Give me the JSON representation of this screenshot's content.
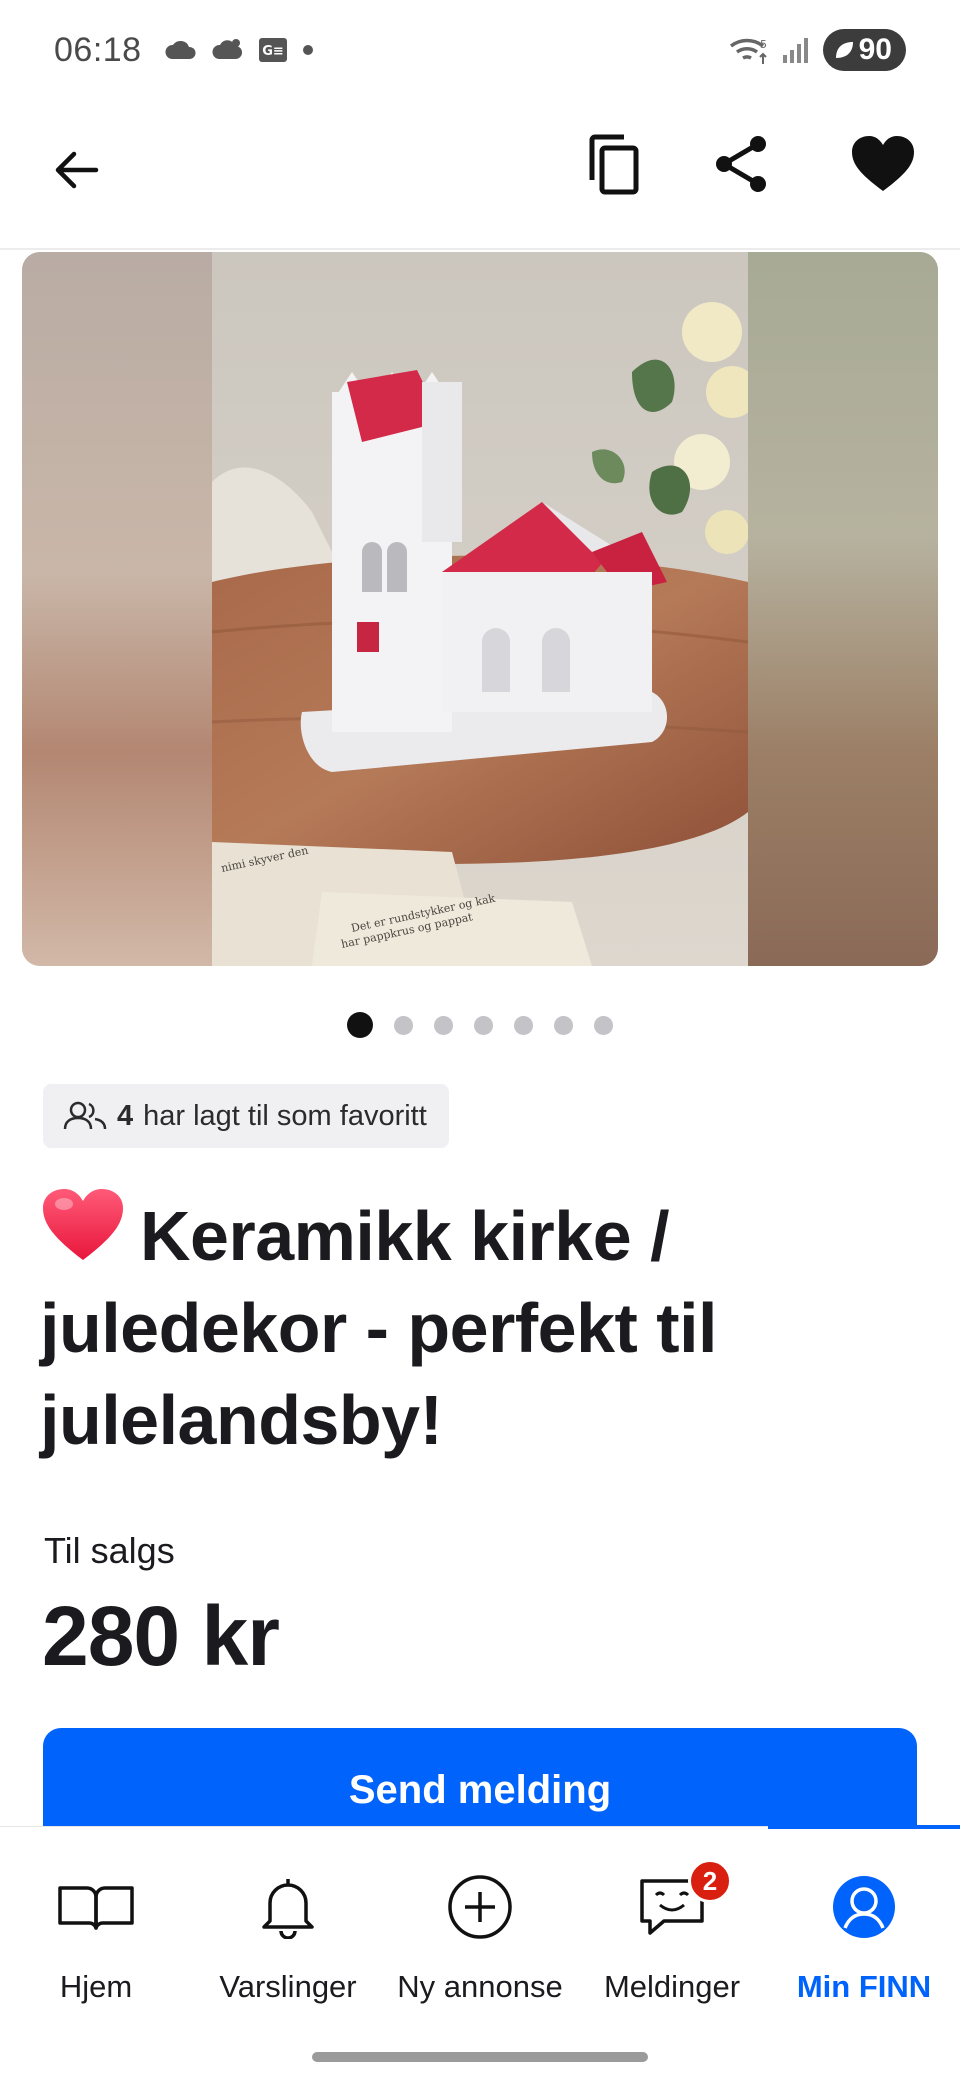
{
  "status_bar": {
    "time": "06:18",
    "battery": "90",
    "icons_left": [
      "cloud-icon",
      "cloud-rain-icon",
      "sim-card-icon",
      "dot-icon"
    ],
    "icons_right": [
      "wifi-icon",
      "signal-icon",
      "battery-icon"
    ]
  },
  "toolbar": {
    "back_icon": "arrow-left-icon",
    "actions": [
      "copy-icon",
      "share-icon",
      "heart-icon"
    ]
  },
  "gallery": {
    "image_count": 7,
    "active_index": 0,
    "dots": [
      true,
      false,
      false,
      false,
      false,
      false,
      false
    ]
  },
  "listing": {
    "favorites_count": "4",
    "favorites_text": "har lagt til som favoritt",
    "title_emoji": "❤️",
    "title": "Keramikk kirke / juledekor - perfekt til julelandsby!",
    "sale_label": "Til salgs",
    "price": "280 kr"
  },
  "actions": {
    "send_message": "Send melding"
  },
  "bottom_nav": {
    "items": [
      {
        "label": "Hjem",
        "icon": "book-icon",
        "active": false
      },
      {
        "label": "Varslinger",
        "icon": "bell-icon",
        "active": false
      },
      {
        "label": "Ny annonse",
        "icon": "plus-circle-icon",
        "active": false
      },
      {
        "label": "Meldinger",
        "icon": "chat-smile-icon",
        "active": false,
        "badge": "2"
      },
      {
        "label": "Min FINN",
        "icon": "profile-icon",
        "active": true
      }
    ]
  },
  "colors": {
    "accent": "#0063fb",
    "badge": "#d91f0f",
    "text": "#1b1b1f"
  }
}
